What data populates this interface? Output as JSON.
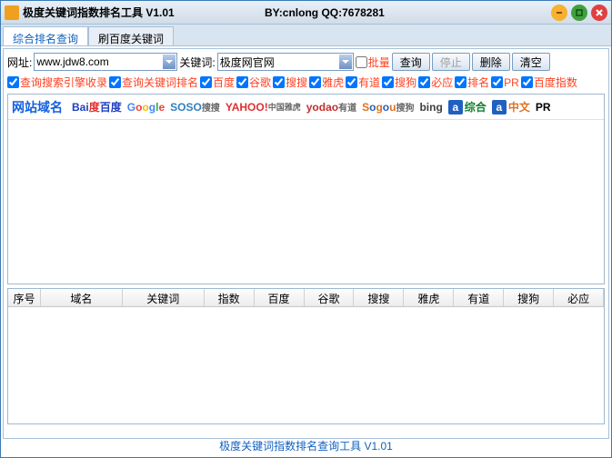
{
  "titlebar": {
    "title": "极度关键词指数排名工具 V1.01",
    "by": "BY:cnlong QQ:7678281"
  },
  "tabs": [
    {
      "label": "综合排名查询",
      "active": true
    },
    {
      "label": "刷百度关键词",
      "active": false
    }
  ],
  "toolbar": {
    "url_label": "网址:",
    "url_value": "www.jdw8.com",
    "kw_label": "关键词:",
    "kw_value": "极度网官网",
    "batch_label": "批量",
    "query_btn": "查询",
    "stop_btn": "停止",
    "delete_btn": "删除",
    "clear_btn": "清空"
  },
  "checks": {
    "c1": "查询搜索引擎收录",
    "c2": "查询关键词排名",
    "c3": "百度",
    "c4": "谷歌",
    "c5": "搜搜",
    "c6": "雅虎",
    "c7": "有道",
    "c8": "搜狗",
    "c9": "必应",
    "c10": "排名",
    "c11": "PR",
    "c12": "百度指数"
  },
  "upper_header": {
    "domain_label": "网站域名",
    "logos": {
      "baidu": "Bai百度",
      "google": "Google",
      "soso": "SOSO搜搜",
      "yahoo": "YAHOO!",
      "yodao": "yodao有道",
      "sogou": "Sogou搜狗",
      "bing": "bing",
      "zonghe": "综合",
      "zhongwen": "中文",
      "pr": "PR"
    }
  },
  "table_headers": {
    "h1": "序号",
    "h2": "域名",
    "h3": "关键词",
    "h4": "指数",
    "h5": "百度",
    "h6": "谷歌",
    "h7": "搜搜",
    "h8": "雅虎",
    "h9": "有道",
    "h10": "搜狗",
    "h11": "必应"
  },
  "footer": "极度关键词指数排名查询工具 V1.01"
}
